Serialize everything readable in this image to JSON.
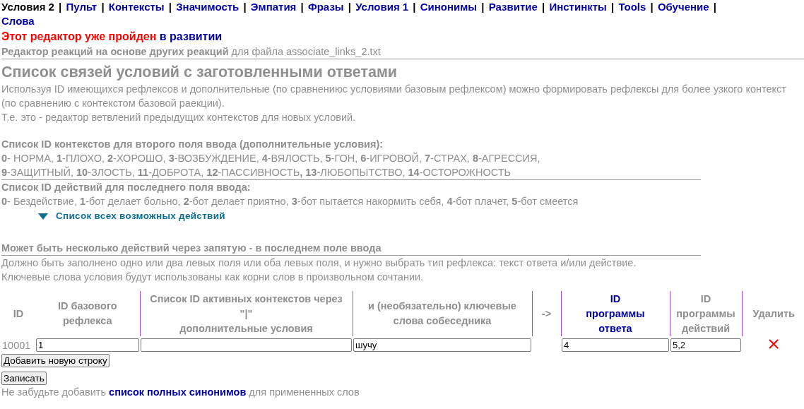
{
  "nav": {
    "separator": "|",
    "items": [
      {
        "label": "Условия 2",
        "selected": true
      },
      {
        "label": "Пульт",
        "selected": false
      },
      {
        "label": "Контексты",
        "selected": false
      },
      {
        "label": "Значимость",
        "selected": false
      },
      {
        "label": "Эмпатия",
        "selected": false
      },
      {
        "label": "Фразы",
        "selected": false
      },
      {
        "label": "Условия 1",
        "selected": false
      },
      {
        "label": "Синонимы",
        "selected": false
      },
      {
        "label": "Развитие",
        "selected": false
      },
      {
        "label": "Инстинкты",
        "selected": false
      },
      {
        "label": "Tools",
        "selected": false
      },
      {
        "label": "Обучение",
        "selected": false
      },
      {
        "label": "Слова",
        "selected": false
      }
    ]
  },
  "notice": {
    "text": "Этот редактор уже пройден",
    "link": "в развитии"
  },
  "subtitle": {
    "title": "Редактор реакций на основе других реакций",
    "file": "для файла associate_links_2.txt"
  },
  "heading": "Список связей условий с заготовленными ответами",
  "description": [
    "Используя ID имеющихся рефлексов и дополнительные (по сравнениюс условиями базовым рефлексом) можно формировать рефлексы для более узкого контекст",
    "(по сравнению с контекстом базовой раекции).",
    "Т.е. это - редактор ветвлений предыдущих контекстов для новых условий."
  ],
  "contexts": {
    "title": "Список ID контекстов для второго поля ввода (дополнительные условия):",
    "lines": [
      "**0**- НОРМА, **1**-ПЛОХО, **2**-ХОРОШО, **3**-ВОЗБУЖДЕНИЕ, **4**-ВЯЛОСТЬ, **5**-ГОН, **6**-ИГРОВОЙ, **7**-СТРАХ, **8**-АГРЕССИЯ,",
      "**9**-ЗАЩИТНЫЙ, **10**-ЗЛОСТЬ, **11**-ДОБРОТА, **12**-ПАССИВНОСТЬ**,** **13**-ЛЮБОПЫТСТВО, **14**-ОСТОРОЖНОСТЬ"
    ]
  },
  "actions": {
    "title": "Список ID действий для последнего поля ввода:",
    "text": "**0**- Бездействие, **1**-бот делает больно, **2**-бот делает приятно, **3**-бот пытается накормить себя, **4**-бот плачет, **5**-бот смеется",
    "toggle": {
      "label": "Список всех возможных действий",
      "expanded": false
    }
  },
  "multi_note": "Может быть несколько действий через запятую - в последнем поле ввода",
  "instructions": [
    "Должно быть заполнено одно или два левых поля или оба левых поля, и нужно выбрать тип рефлекса: текст ответа и/или действие.",
    "Ключевые слова условия будут использованы как корни слов в произвольном сочтании."
  ],
  "table": {
    "columns": [
      {
        "lines": [
          "ID"
        ],
        "highlighted": false
      },
      {
        "lines": [
          "ID базового",
          "рефлекса"
        ],
        "highlighted": false
      },
      {
        "lines": [
          "Список ID активных контекстов через",
          "\"|\"",
          "дополнительные условия"
        ],
        "highlighted": false
      },
      {
        "lines": [
          "и (необязательно) ключевые",
          "слова собеседника"
        ],
        "highlighted": false
      },
      {
        "lines": [
          "->"
        ],
        "highlighted": false
      },
      {
        "lines": [
          "ID",
          "программы",
          "ответа"
        ],
        "highlighted": true
      },
      {
        "lines": [
          "ID",
          "программы",
          "действий"
        ],
        "highlighted": false
      },
      {
        "lines": [
          "Удалить"
        ],
        "highlighted": false
      }
    ],
    "rows": [
      {
        "id": "10001",
        "base": "1",
        "contexts": "",
        "keywords": "шучу",
        "answer": "4",
        "action": "5,2"
      }
    ]
  },
  "buttons": {
    "add": "Добавить новую строку",
    "save": "Записать"
  },
  "footer": {
    "before": "Не забудьте добавить",
    "link": "список полных синонимов",
    "after": "для примененных слов"
  }
}
